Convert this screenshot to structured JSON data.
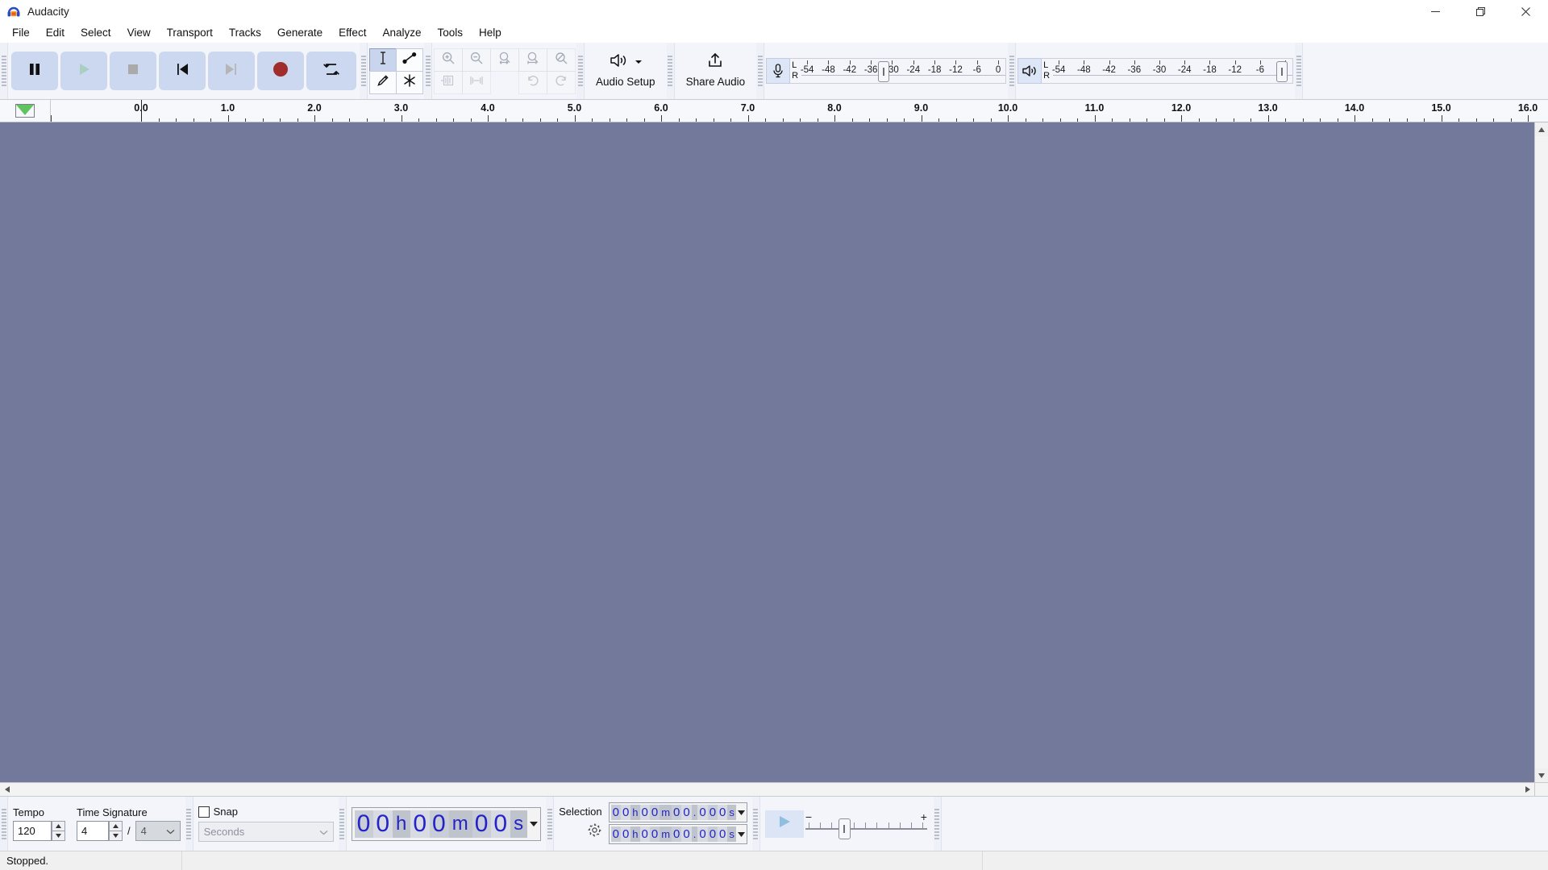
{
  "window": {
    "title": "Audacity",
    "app_icon": "audacity-headphones-icon",
    "buttons": {
      "minimize": "minimize-icon",
      "maximize": "maximize-icon",
      "close": "close-icon"
    }
  },
  "menu": {
    "items": [
      {
        "label": "File"
      },
      {
        "label": "Edit"
      },
      {
        "label": "Select"
      },
      {
        "label": "View"
      },
      {
        "label": "Transport"
      },
      {
        "label": "Tracks"
      },
      {
        "label": "Generate"
      },
      {
        "label": "Effect"
      },
      {
        "label": "Analyze"
      },
      {
        "label": "Tools"
      },
      {
        "label": "Help"
      }
    ]
  },
  "transport": {
    "buttons": [
      {
        "name": "pause",
        "icon": "pause-icon",
        "enabled": true
      },
      {
        "name": "play",
        "icon": "play-icon",
        "enabled": false
      },
      {
        "name": "stop",
        "icon": "stop-icon",
        "enabled": false
      },
      {
        "name": "skip-to-start",
        "icon": "skip-start-icon",
        "enabled": true
      },
      {
        "name": "skip-to-end",
        "icon": "skip-end-icon",
        "enabled": false
      },
      {
        "name": "record",
        "icon": "record-icon",
        "enabled": true
      },
      {
        "name": "loop",
        "icon": "loop-icon",
        "enabled": true
      }
    ]
  },
  "tools": {
    "items": [
      {
        "name": "selection-tool",
        "icon": "i-beam-icon",
        "active": true
      },
      {
        "name": "envelope-tool",
        "icon": "envelope-icon",
        "active": false
      },
      {
        "name": "draw-tool",
        "icon": "pencil-icon",
        "active": false
      },
      {
        "name": "multi-tool",
        "icon": "asterisk-icon",
        "active": false
      }
    ]
  },
  "edit_toolbar": {
    "items": [
      {
        "name": "zoom-in",
        "icon": "zoom-in-icon",
        "enabled": false
      },
      {
        "name": "zoom-out",
        "icon": "zoom-out-icon",
        "enabled": false
      },
      {
        "name": "fit-selection-to-width",
        "icon": "fit-selection-icon",
        "enabled": false
      },
      {
        "name": "fit-project-to-width",
        "icon": "fit-project-icon",
        "enabled": false
      },
      {
        "name": "zoom-toggle",
        "icon": "zoom-toggle-icon",
        "enabled": false
      },
      {
        "name": "trim-audio-outside-selection",
        "icon": "trim-audio-icon",
        "enabled": false
      },
      {
        "name": "silence-audio-selection",
        "icon": "silence-audio-icon",
        "enabled": false
      },
      {
        "name": "undo",
        "icon": "undo-icon",
        "enabled": false
      },
      {
        "name": "redo",
        "icon": "redo-icon",
        "enabled": false
      }
    ]
  },
  "audio_setup": {
    "label": "Audio Setup",
    "icon": "speaker-icon",
    "caret": "chevron-down-icon"
  },
  "share_audio": {
    "label": "Share Audio",
    "icon": "upload-icon"
  },
  "recording_meter": {
    "icon": "microphone-icon",
    "channels": [
      "L",
      "R"
    ],
    "ticks": [
      "-54",
      "-48",
      "-42",
      "-36",
      "-30",
      "-24",
      "-18",
      "-12",
      "-6",
      "0"
    ],
    "handle_position_db": -36
  },
  "playback_meter": {
    "icon": "speaker-icon",
    "channels": [
      "L",
      "R"
    ],
    "ticks": [
      "-54",
      "-48",
      "-42",
      "-36",
      "-30",
      "-24",
      "-18",
      "-12",
      "-6",
      "0"
    ],
    "handle_position_db": 0
  },
  "timeline": {
    "pin_icon": "pinned-play-head-icon",
    "labels": [
      "0.0",
      "1.0",
      "2.0",
      "3.0",
      "4.0",
      "5.0",
      "6.0",
      "7.0",
      "8.0",
      "9.0",
      "10.0",
      "11.0",
      "12.0",
      "13.0",
      "14.0",
      "15.0",
      "16.0"
    ],
    "playhead_label": "0.0"
  },
  "track_panel": {
    "background_color": "#73799b",
    "empty": true
  },
  "scrollbars": {
    "vertical": {
      "up": "chevron-up-icon",
      "down": "chevron-down-icon"
    },
    "horizontal": {
      "left": "chevron-left-icon",
      "right": "chevron-right-icon"
    }
  },
  "time_signature_toolbar": {
    "tempo_label": "Tempo",
    "tempo_value": "120",
    "time_signature_label": "Time Signature",
    "upper_value": "4",
    "divider": "/",
    "lower_value": "4"
  },
  "snap_toolbar": {
    "label": "Snap",
    "checked": false,
    "dropdown_value": "Seconds"
  },
  "time_toolbar": {
    "digits": [
      "0",
      "0",
      "h",
      "0",
      "0",
      "m",
      "0",
      "0",
      "s"
    ],
    "caret": "chevron-down-icon"
  },
  "selection_toolbar": {
    "label": "Selection",
    "settings_icon": "gear-icon",
    "start": "00h00m00.000s",
    "end": "00h00m00.000s",
    "start_digits": [
      "0",
      "0",
      "h",
      "0",
      "0",
      "m",
      "0",
      "0",
      ".",
      "0",
      "0",
      "0",
      "s"
    ],
    "end_digits": [
      "0",
      "0",
      "h",
      "0",
      "0",
      "m",
      "0",
      "0",
      ".",
      "0",
      "0",
      "0",
      "s"
    ]
  },
  "play_speed_toolbar": {
    "play_icon": "play-at-speed-icon",
    "minus": "−",
    "plus": "+",
    "handle_percent": 31
  },
  "status_bar": {
    "message": "Stopped.",
    "cells": [
      "Stopped.",
      "",
      "",
      ""
    ]
  },
  "colors": {
    "track_background": "#73799b",
    "toolbar_background": "#f3f5fa",
    "button_blue": "#ccd8ef",
    "record_red": "#a02c2c",
    "pin_green": "#5fc35f",
    "digit_blue": "#2323c8",
    "accent_selected": "#c9d5ec"
  }
}
